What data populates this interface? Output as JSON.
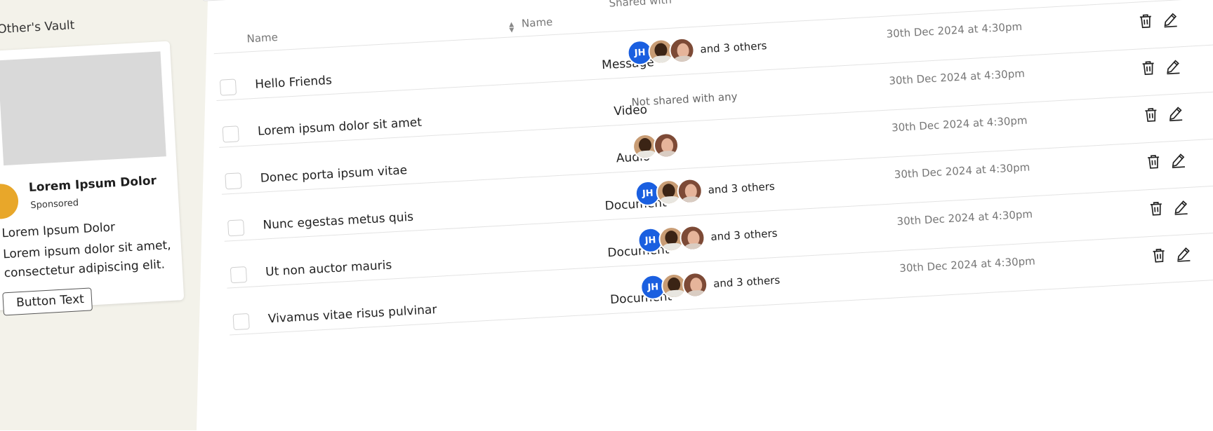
{
  "sidebar": {
    "vault_title": "Other's Vault",
    "ad": {
      "title": "Lorem Ipsum Dolor",
      "sponsored": "Sponsored",
      "headline": "Lorem Ipsum Dolor",
      "body": "Lorem ipsum dolor sit amet, consectetur adipiscing elit.",
      "button_label": "Button Text",
      "avatar_color": "#e8a72a"
    }
  },
  "table": {
    "headers": {
      "name": "Name",
      "type": "Name",
      "shared_with": "Shared with"
    },
    "rows": [
      {
        "name": "Hello Friends",
        "type": "Message",
        "shared": {
          "initials": "JH",
          "photos": [
            "avatar-man",
            "avatar-woman"
          ],
          "others": "and 3 others"
        },
        "date": "30th Dec 2024 at 4:30pm"
      },
      {
        "name": "Lorem ipsum dolor sit amet",
        "type": "Video",
        "shared": {
          "not_shared_text": "Not shared with any"
        },
        "date": "30th Dec 2024 at 4:30pm"
      },
      {
        "name": "Donec porta ipsum vitae",
        "type": "Audio",
        "shared": {
          "photos": [
            "avatar-man",
            "avatar-woman"
          ]
        },
        "date": "30th Dec 2024 at 4:30pm"
      },
      {
        "name": "Nunc egestas metus quis",
        "type": "Document",
        "shared": {
          "initials": "JH",
          "photos": [
            "avatar-man",
            "avatar-woman"
          ],
          "others": "and 3 others"
        },
        "date": "30th Dec 2024 at 4:30pm"
      },
      {
        "name": "Ut non auctor mauris",
        "type": "Document",
        "shared": {
          "initials": "JH",
          "photos": [
            "avatar-man",
            "avatar-woman"
          ],
          "others": "and 3 others"
        },
        "date": "30th Dec 2024 at 4:30pm"
      },
      {
        "name": "Vivamus vitae risus pulvinar",
        "type": "Document",
        "shared": {
          "initials": "JH",
          "photos": [
            "avatar-man",
            "avatar-woman"
          ],
          "others": "and 3 others"
        },
        "date": "30th Dec 2024 at 4:30pm"
      }
    ]
  },
  "icons": {
    "delete": "trash-icon",
    "edit": "pencil-icon",
    "sort": "sort-icon"
  },
  "colors": {
    "sidebar_bg": "#f3f2ea",
    "avatar_jh": "#1a5fe0"
  }
}
